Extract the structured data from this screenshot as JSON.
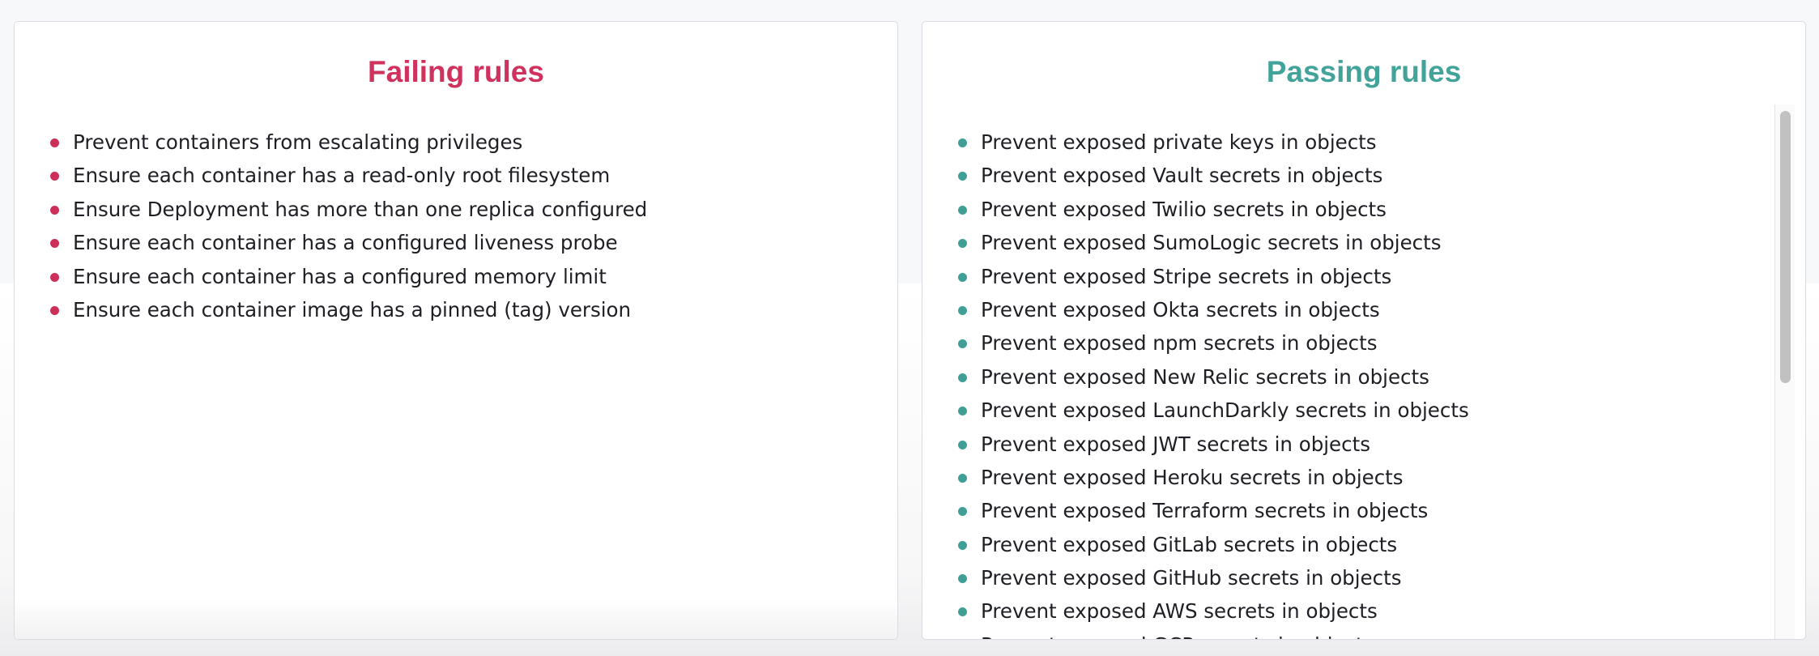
{
  "failing": {
    "title": "Failing rules",
    "color": "#d0325e",
    "rules": [
      "Prevent containers from escalating privileges",
      "Ensure each container has a read-only root filesystem",
      "Ensure Deployment has more than one replica configured",
      "Ensure each container has a configured liveness probe",
      "Ensure each container has a configured memory limit",
      "Ensure each container image has a pinned (tag) version"
    ]
  },
  "passing": {
    "title": "Passing rules",
    "color": "#42a39a",
    "rules": [
      "Prevent exposed private keys in objects",
      "Prevent exposed Vault secrets in objects",
      "Prevent exposed Twilio secrets in objects",
      "Prevent exposed SumoLogic secrets in objects",
      "Prevent exposed Stripe secrets in objects",
      "Prevent exposed Okta secrets in objects",
      "Prevent exposed npm secrets in objects",
      "Prevent exposed New Relic secrets in objects",
      "Prevent exposed LaunchDarkly secrets in objects",
      "Prevent exposed JWT secrets in objects",
      "Prevent exposed Heroku secrets in objects",
      "Prevent exposed Terraform secrets in objects",
      "Prevent exposed GitLab secrets in objects",
      "Prevent exposed GitHub secrets in objects",
      "Prevent exposed AWS secrets in objects",
      "Prevent exposed GCP secrets in objects"
    ]
  }
}
